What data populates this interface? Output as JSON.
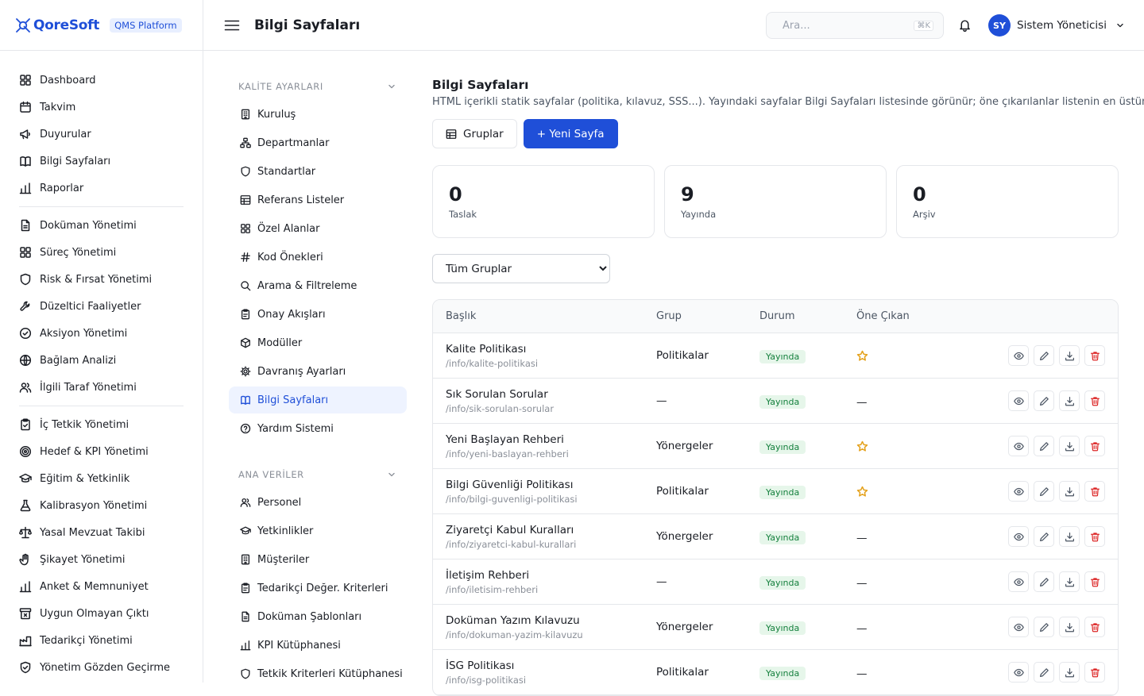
{
  "brand": {
    "name": "QoreSoft",
    "badge": "QMS Platform",
    "accent": "#1f4fd8"
  },
  "topbar": {
    "title": "Bilgi Sayfaları",
    "search_placeholder": "Ara...",
    "search_shortcut": "⌘K",
    "user_initials": "SY",
    "user_name": "Sistem Yöneticisi"
  },
  "sidebar": {
    "groups": [
      [
        {
          "label": "Dashboard",
          "icon": "dashboard-icon"
        },
        {
          "label": "Takvim",
          "icon": "calendar-icon"
        },
        {
          "label": "Duyurular",
          "icon": "megaphone-icon"
        },
        {
          "label": "Bilgi Sayfaları",
          "icon": "book-icon"
        },
        {
          "label": "Raporlar",
          "icon": "bar-chart-icon"
        }
      ],
      [
        {
          "label": "Doküman Yönetimi",
          "icon": "document-icon"
        },
        {
          "label": "Süreç Yönetimi",
          "icon": "grid-icon"
        },
        {
          "label": "Risk & Fırsat Yönetimi",
          "icon": "shield-icon"
        },
        {
          "label": "Düzeltici Faaliyetler",
          "icon": "wrench-icon"
        },
        {
          "label": "Aksiyon Yönetimi",
          "icon": "check-circle-icon"
        },
        {
          "label": "Bağlam Analizi",
          "icon": "globe-icon"
        },
        {
          "label": "İlgili Taraf Yönetimi",
          "icon": "users-icon"
        }
      ],
      [
        {
          "label": "İç Tetkik Yönetimi",
          "icon": "clipboard-check-icon"
        },
        {
          "label": "Hedef & KPI Yönetimi",
          "icon": "target-icon"
        },
        {
          "label": "Eğitim & Yetkinlik",
          "icon": "graduation-cap-icon"
        },
        {
          "label": "Kalibrasyon Yönetimi",
          "icon": "flask-icon"
        },
        {
          "label": "Yasal Mevzuat Takibi",
          "icon": "scale-icon"
        },
        {
          "label": "Şikayet Yönetimi",
          "icon": "hand-icon"
        },
        {
          "label": "Anket & Memnuniyet",
          "icon": "bar-chart-icon"
        },
        {
          "label": "Uygun Olmayan Çıktı",
          "icon": "archive-x-icon"
        },
        {
          "label": "Tedarikçi Yönetimi",
          "icon": "factory-icon"
        },
        {
          "label": "Yönetim Gözden Geçirme",
          "icon": "shield-check-icon"
        }
      ]
    ]
  },
  "settings_menu": {
    "sections": [
      {
        "title": "KALİTE AYARLARI",
        "items": [
          {
            "label": "Kuruluş",
            "icon": "building-icon"
          },
          {
            "label": "Departmanlar",
            "icon": "org-chart-icon"
          },
          {
            "label": "Standartlar",
            "icon": "shield-icon"
          },
          {
            "label": "Referans Listeler",
            "icon": "table-icon"
          },
          {
            "label": "Özel Alanlar",
            "icon": "grid-icon"
          },
          {
            "label": "Kod Önekleri",
            "icon": "hash-icon"
          },
          {
            "label": "Arama & Filtreleme",
            "icon": "search-icon"
          },
          {
            "label": "Onay Akışları",
            "icon": "clipboard-icon"
          },
          {
            "label": "Modüller",
            "icon": "cube-icon"
          },
          {
            "label": "Davranış Ayarları",
            "icon": "gear-icon"
          },
          {
            "label": "Bilgi Sayfaları",
            "icon": "book-icon",
            "active": true
          },
          {
            "label": "Yardım Sistemi",
            "icon": "help-circle-icon"
          }
        ]
      },
      {
        "title": "ANA VERİLER",
        "items": [
          {
            "label": "Personel",
            "icon": "users-icon"
          },
          {
            "label": "Yetkinlikler",
            "icon": "graduation-cap-icon"
          },
          {
            "label": "Müşteriler",
            "icon": "building-icon"
          },
          {
            "label": "Tedarikçi Değer. Kriterleri",
            "icon": "clipboard-icon"
          },
          {
            "label": "Doküman Şablonları",
            "icon": "document-icon"
          },
          {
            "label": "KPI Kütüphanesi",
            "icon": "bar-chart-icon"
          },
          {
            "label": "Tetkik Kriterleri Kütüphanesi",
            "icon": "shield-icon"
          }
        ]
      }
    ]
  },
  "main": {
    "title": "Bilgi Sayfaları",
    "subtitle": "HTML içerikli statik sayfalar (politika, kılavuz, SSS...). Yayındaki sayfalar Bilgi Sayfaları listesinde görünür; öne çıkarılanlar listenin en üstünde.",
    "groups_button": "Gruplar",
    "new_button": "+ Yeni Sayfa",
    "stats": [
      {
        "value": "0",
        "label": "Taslak"
      },
      {
        "value": "9",
        "label": "Yayında"
      },
      {
        "value": "0",
        "label": "Arşiv"
      }
    ],
    "filter": {
      "selected": "Tüm Gruplar"
    },
    "table": {
      "headers": [
        "Başlık",
        "Grup",
        "Durum",
        "Öne Çıkan"
      ],
      "rows": [
        {
          "title": "Kalite Politikası",
          "slug": "/info/kalite-politikasi",
          "group": "Politikalar",
          "status": "Yayında",
          "featured": true
        },
        {
          "title": "Sık Sorulan Sorular",
          "slug": "/info/sik-sorulan-sorular",
          "group": "—",
          "status": "Yayında",
          "featured": false
        },
        {
          "title": "Yeni Başlayan Rehberi",
          "slug": "/info/yeni-baslayan-rehberi",
          "group": "Yönergeler",
          "status": "Yayında",
          "featured": true
        },
        {
          "title": "Bilgi Güvenliği Politikası",
          "slug": "/info/bilgi-guvenligi-politikasi",
          "group": "Politikalar",
          "status": "Yayında",
          "featured": true
        },
        {
          "title": "Ziyaretçi Kabul Kuralları",
          "slug": "/info/ziyaretci-kabul-kurallari",
          "group": "Yönergeler",
          "status": "Yayında",
          "featured": false
        },
        {
          "title": "İletişim Rehberi",
          "slug": "/info/iletisim-rehberi",
          "group": "—",
          "status": "Yayında",
          "featured": false
        },
        {
          "title": "Doküman Yazım Kılavuzu",
          "slug": "/info/dokuman-yazim-kilavuzu",
          "group": "Yönergeler",
          "status": "Yayında",
          "featured": false
        },
        {
          "title": "İSG Politikası",
          "slug": "/info/isg-politikasi",
          "group": "Politikalar",
          "status": "Yayında",
          "featured": false
        }
      ],
      "not_featured_mark": "—"
    }
  }
}
